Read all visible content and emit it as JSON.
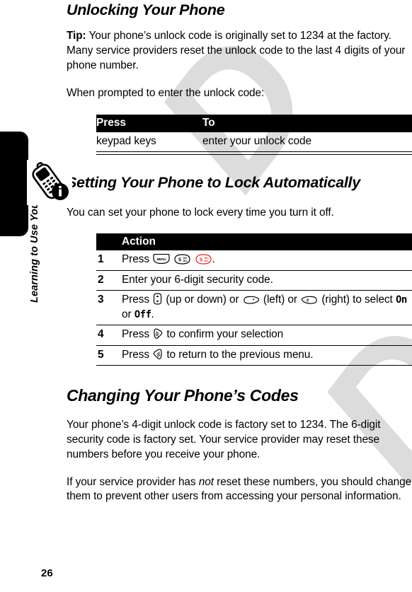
{
  "page": {
    "folio": "26",
    "running_head": "Learning to Use Your Phone",
    "watermark_text": "D"
  },
  "sections": [
    {
      "id": "unlocking",
      "title": "Unlocking Your Phone",
      "paragraphs": [
        {
          "lead": "Tip:",
          "text": " Your phone’s unlock code is originally set to 1234 at the factory. Many service providers reset the unlock code to the last 4 digits of your phone number."
        },
        {
          "lead": "",
          "text": "When prompted to enter the unlock code:"
        }
      ],
      "table": {
        "headers": [
          "Press",
          "To"
        ],
        "rows": [
          [
            "keypad keys",
            "enter your unlock code"
          ]
        ]
      }
    },
    {
      "id": "auto-lock",
      "title": "Setting Your Phone to Lock Automatically",
      "paragraphs": [
        {
          "lead": "",
          "text": "You can set your phone to lock every time you turn it off."
        }
      ],
      "table": {
        "headers": [
          "Action"
        ],
        "rows": [
          {
            "num": "1",
            "parts": [
              {
                "t": "text",
                "v": "Press "
              },
              {
                "t": "key",
                "v": "menu-key",
                "label": "MENU"
              },
              {
                "t": "text",
                "v": " "
              },
              {
                "t": "key",
                "v": "five-jkl-key",
                "label": "5 JKL"
              },
              {
                "t": "text",
                "v": " "
              },
              {
                "t": "key",
                "v": "five-jkl-key-red",
                "label": "5 JKL"
              },
              {
                "t": "text",
                "v": "."
              }
            ]
          },
          {
            "num": "2",
            "parts": [
              {
                "t": "text",
                "v": "Enter your 6-digit security code."
              }
            ]
          },
          {
            "num": "3",
            "parts": [
              {
                "t": "text",
                "v": "Press "
              },
              {
                "t": "key",
                "v": "navigation-key",
                "label": ""
              },
              {
                "t": "text",
                "v": " (up or down) or "
              },
              {
                "t": "key",
                "v": "star-softkey",
                "label": "*"
              },
              {
                "t": "text",
                "v": " (left) or "
              },
              {
                "t": "key",
                "v": "pound-softkey",
                "label": "#"
              },
              {
                "t": "text",
                "v": " (right) to select "
              },
              {
                "t": "mono",
                "v": "On"
              },
              {
                "t": "text",
                "v": " or "
              },
              {
                "t": "mono",
                "v": "Off"
              },
              {
                "t": "text",
                "v": "."
              }
            ]
          },
          {
            "num": "4",
            "parts": [
              {
                "t": "text",
                "v": "Press "
              },
              {
                "t": "key",
                "v": "left-softkey",
                "label": ""
              },
              {
                "t": "text",
                "v": " to confirm your selection"
              }
            ]
          },
          {
            "num": "5",
            "parts": [
              {
                "t": "text",
                "v": "Press "
              },
              {
                "t": "key",
                "v": "right-softkey",
                "label": ""
              },
              {
                "t": "text",
                "v": " to return to the previous menu."
              }
            ]
          }
        ]
      }
    },
    {
      "id": "changing-codes",
      "title": "Changing Your Phone’s Codes",
      "paragraphs": [
        {
          "lead": "",
          "text": "Your phone’s 4-digit unlock code is factory set to 1234. The 6-digit security code is factory set. Your service provider may reset these numbers before you receive your phone."
        },
        {
          "lead": "",
          "text_pre": "If your service provider has ",
          "text_em": "not",
          "text_post": " reset these numbers, you should change them to prevent other users from accessing your personal information."
        }
      ]
    }
  ],
  "icons": {
    "note": "phone-info-icon",
    "menu_key_label": "MENU",
    "key_5_digit": "5",
    "key_5_letters": "JKL",
    "star_label": "*",
    "pound_label": "#"
  },
  "colors": {
    "ink": "#000000",
    "paper": "#ffffff",
    "watermark": "#dcdcdc",
    "highlight_key_red": "#ee2222",
    "table_header_bg": "#000000",
    "table_header_text": "#ffffff"
  }
}
